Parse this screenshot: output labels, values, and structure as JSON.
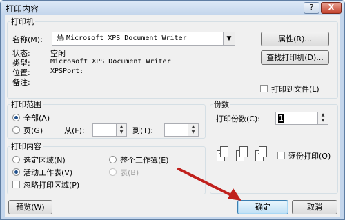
{
  "window": {
    "title": "打印内容",
    "help": "?",
    "close": "X"
  },
  "printer": {
    "group_label": "打印机",
    "name_label": "名称(M):",
    "name_value": "Microsoft XPS Document Writer",
    "status_label": "状态:",
    "status_value": "空闲",
    "type_label": "类型:",
    "type_value": "Microsoft XPS Document Writer",
    "where_label": "位置:",
    "where_value": "XPSPort:",
    "comment_label": "备注:",
    "properties_button": "属性(R)...",
    "find_button": "查找打印机(D)...",
    "print_to_file": "打印到文件(L)"
  },
  "range": {
    "group_label": "打印范围",
    "all": "全部(A)",
    "pages": "页(G)",
    "from": "从(F):",
    "to": "到(T):"
  },
  "what": {
    "group_label": "打印内容",
    "selection": "选定区域(N)",
    "workbook": "整个工作簿(E)",
    "active_sheets": "活动工作表(V)",
    "table": "表(B)",
    "ignore_areas": "忽略打印区域(P)"
  },
  "copies": {
    "group_label": "份数",
    "number_label": "打印份数(C):",
    "number_value": "1",
    "collate": "逐份打印(O)"
  },
  "buttons": {
    "preview": "预览(W)",
    "ok": "确定",
    "cancel": "取消"
  },
  "colors": {
    "arrow": "#c0201c",
    "title_bg": "#c4d6ec"
  }
}
